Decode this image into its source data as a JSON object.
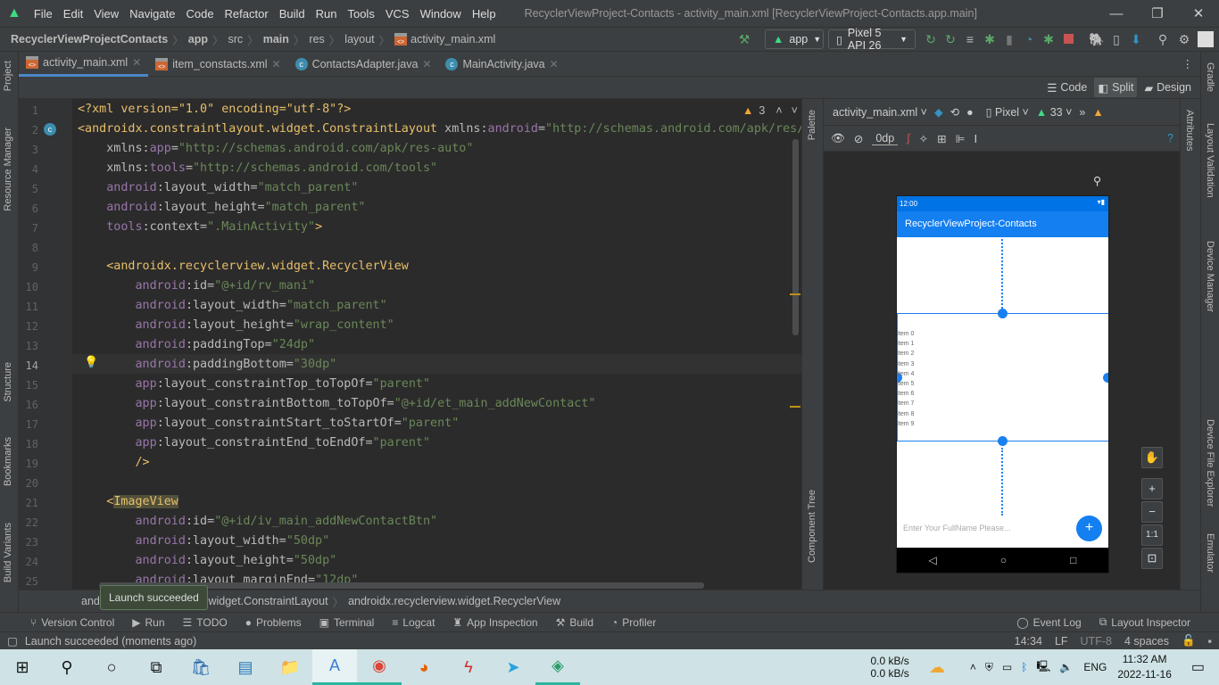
{
  "menu": [
    "File",
    "Edit",
    "View",
    "Navigate",
    "Code",
    "Refactor",
    "Build",
    "Run",
    "Tools",
    "VCS",
    "Window",
    "Help"
  ],
  "window_title": "RecyclerViewProject-Contacts - activity_main.xml [RecyclerViewProject-Contacts.app.main]",
  "breadcrumb": [
    "RecyclerViewProjectContacts",
    "app",
    "src",
    "main",
    "res",
    "layout",
    "activity_main.xml"
  ],
  "run_config": "app",
  "device": "Pixel 5 API 26",
  "tabs": [
    {
      "label": "activity_main.xml",
      "type": "xml",
      "active": true
    },
    {
      "label": "item_constacts.xml",
      "type": "xml",
      "active": false
    },
    {
      "label": "ContactsAdapter.java",
      "type": "class",
      "active": false
    },
    {
      "label": "MainActivity.java",
      "type": "class",
      "active": false
    }
  ],
  "modes": [
    "Code",
    "Split",
    "Design"
  ],
  "selected_mode": "Split",
  "warnings_count": "3",
  "left_tools": [
    "Project",
    "Resource Manager",
    "Structure",
    "Bookmarks",
    "Build Variants"
  ],
  "right_tools": [
    "Gradle",
    "Layout Validation",
    "Device Manager",
    "Device File Explorer",
    "Emulator"
  ],
  "design_strips": {
    "palette": "Palette",
    "component_tree": "Component Tree",
    "attributes": "Attributes"
  },
  "design_toolbar": {
    "file": "activity_main.xml",
    "device": "Pixel",
    "api": "33",
    "margin": "0dp"
  },
  "code_lines": [
    [
      [
        "pi",
        "<?xml version=\"1.0\" encoding=\"utf-8\"?>"
      ]
    ],
    [
      [
        "tag",
        "<androidx.constraintlayout.widget.ConstraintLayout "
      ],
      [
        "attr",
        "xmlns:"
      ],
      [
        "ns",
        "android"
      ],
      [
        "attr",
        "="
      ],
      [
        "str",
        "\"http://schemas.android.com/apk/res/android\""
      ]
    ],
    [
      [
        "attr",
        "    xmlns:"
      ],
      [
        "ns",
        "app"
      ],
      [
        "attr",
        "="
      ],
      [
        "str",
        "\"http://schemas.android.com/apk/res-auto\""
      ]
    ],
    [
      [
        "attr",
        "    xmlns:"
      ],
      [
        "ns",
        "tools"
      ],
      [
        "attr",
        "="
      ],
      [
        "str",
        "\"http://schemas.android.com/tools\""
      ]
    ],
    [
      [
        "ns",
        "    android"
      ],
      [
        "attr",
        ":layout_width="
      ],
      [
        "str",
        "\"match_parent\""
      ]
    ],
    [
      [
        "ns",
        "    android"
      ],
      [
        "attr",
        ":layout_height="
      ],
      [
        "str",
        "\"match_parent\""
      ]
    ],
    [
      [
        "ns",
        "    tools"
      ],
      [
        "attr",
        ":context="
      ],
      [
        "str",
        "\".MainActivity\""
      ],
      [
        "tag",
        ">"
      ]
    ],
    [],
    [
      [
        "tag",
        "    <androidx.recyclerview.widget.RecyclerView"
      ]
    ],
    [
      [
        "ns",
        "        android"
      ],
      [
        "attr",
        ":id="
      ],
      [
        "str",
        "\"@+id/rv_mani\""
      ]
    ],
    [
      [
        "ns",
        "        android"
      ],
      [
        "attr",
        ":layout_width="
      ],
      [
        "str",
        "\"match_parent\""
      ]
    ],
    [
      [
        "ns",
        "        android"
      ],
      [
        "attr",
        ":layout_height="
      ],
      [
        "str",
        "\"wrap_content\""
      ]
    ],
    [
      [
        "ns",
        "        android"
      ],
      [
        "attr",
        ":paddingTop="
      ],
      [
        "str",
        "\"24dp\""
      ]
    ],
    [
      [
        "ns",
        "        android"
      ],
      [
        "attr",
        ":paddingBottom="
      ],
      [
        "str",
        "\"30dp\""
      ]
    ],
    [
      [
        "ns",
        "        app"
      ],
      [
        "attr",
        ":layout_constraintTop_toTopOf="
      ],
      [
        "str",
        "\"parent\""
      ]
    ],
    [
      [
        "ns",
        "        app"
      ],
      [
        "attr",
        ":layout_constraintBottom_toTopOf="
      ],
      [
        "str",
        "\"@+id/et_main_addNewContact\""
      ]
    ],
    [
      [
        "ns",
        "        app"
      ],
      [
        "attr",
        ":layout_constraintStart_toStartOf="
      ],
      [
        "str",
        "\"parent\""
      ]
    ],
    [
      [
        "ns",
        "        app"
      ],
      [
        "attr",
        ":layout_constraintEnd_toEndOf="
      ],
      [
        "str",
        "\"parent\""
      ]
    ],
    [
      [
        "tag",
        "        />"
      ]
    ],
    [],
    [
      [
        "tag",
        "    <"
      ],
      [
        "hl",
        "ImageView"
      ]
    ],
    [
      [
        "ns",
        "        android"
      ],
      [
        "attr",
        ":id="
      ],
      [
        "str",
        "\"@+id/iv_main_addNewContactBtn\""
      ]
    ],
    [
      [
        "ns",
        "        android"
      ],
      [
        "attr",
        ":layout_width="
      ],
      [
        "str",
        "\"50dp\""
      ]
    ],
    [
      [
        "ns",
        "        android"
      ],
      [
        "attr",
        ":layout_height="
      ],
      [
        "str",
        "\"50dp\""
      ]
    ],
    [
      [
        "ns",
        "        android"
      ],
      [
        "attr",
        ":layout_marginEnd="
      ],
      [
        "str",
        "\"12dp\""
      ]
    ]
  ],
  "current_line": 14,
  "preview": {
    "time": "12:00",
    "app_title": "RecyclerViewProject-Contacts",
    "items": [
      "Item 0",
      "Item 1",
      "Item 2",
      "Item 3",
      "Item 4",
      "Item 5",
      "Item 6",
      "Item 7",
      "Item 8",
      "Item 9"
    ],
    "input_hint": "Enter Your FullName Please...",
    "fab": "+",
    "primary_color": "#137ff0"
  },
  "zoom_controls": [
    "pan",
    "+",
    "−",
    "1:1",
    "fit"
  ],
  "bottom_breadcrumb": [
    "androidx.constraintlayout.widget.ConstraintLayout",
    "androidx.recyclerview.widget.RecyclerView"
  ],
  "tooltip": "Launch succeeded",
  "tool_windows": [
    "Version Control",
    "Run",
    "TODO",
    "Problems",
    "Terminal",
    "Logcat",
    "App Inspection",
    "Build",
    "Profiler"
  ],
  "tool_windows_right": [
    "Event Log",
    "Layout Inspector"
  ],
  "status": {
    "message": "Launch succeeded (moments ago)",
    "position": "14:34",
    "line_sep": "LF",
    "encoding": "UTF-8",
    "indent": "4 spaces"
  },
  "taskbar": {
    "net_up": "0.0 kB/s",
    "net_down": "0.0 kB/s",
    "lang": "ENG",
    "time": "11:32 AM",
    "date": "2022-11-16"
  }
}
